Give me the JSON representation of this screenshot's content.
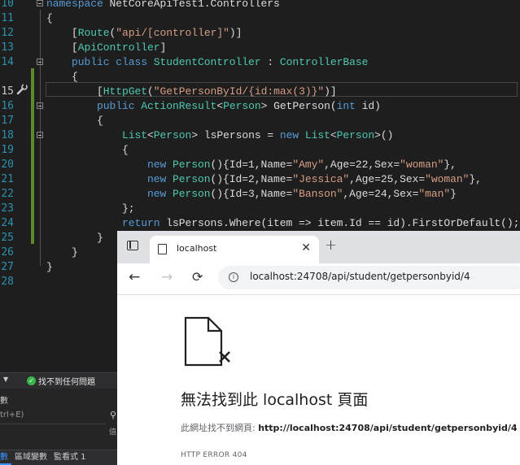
{
  "editor": {
    "lines": [
      {
        "n": "10",
        "tokens": [
          [
            "kw",
            "namespace "
          ],
          [
            "pl",
            "NetCoreApiTest1.Controllers"
          ]
        ]
      },
      {
        "n": "11",
        "tokens": [
          [
            "pl",
            "{"
          ]
        ]
      },
      {
        "n": "12",
        "tokens": [
          [
            "pl",
            "    ["
          ],
          [
            "at",
            "Route"
          ],
          [
            "pl",
            "("
          ],
          [
            "st",
            "\"api/[controller]\""
          ],
          [
            "pl",
            ")]"
          ]
        ]
      },
      {
        "n": "13",
        "tokens": [
          [
            "pl",
            "    ["
          ],
          [
            "at",
            "ApiController"
          ],
          [
            "pl",
            "]"
          ]
        ]
      },
      {
        "n": "14",
        "tokens": [
          [
            "kw",
            "    public class "
          ],
          [
            "ty",
            "StudentController"
          ],
          [
            "pl",
            " : "
          ],
          [
            "ty",
            "ControllerBase"
          ]
        ]
      },
      {
        "n": "14b",
        "tokens": [
          [
            "pl",
            "    {"
          ]
        ]
      },
      {
        "n": "15",
        "tokens": [
          [
            "pl",
            "        ["
          ],
          [
            "at",
            "HttpGet"
          ],
          [
            "pl",
            "("
          ],
          [
            "st",
            "\"GetPersonById/{id:max(3)}\""
          ],
          [
            "pl",
            ")]"
          ]
        ]
      },
      {
        "n": "16",
        "tokens": [
          [
            "kw",
            "        public "
          ],
          [
            "ty",
            "ActionResult"
          ],
          [
            "pl",
            "<"
          ],
          [
            "ty",
            "Person"
          ],
          [
            "pl",
            "> GetPerson("
          ],
          [
            "kw",
            "int"
          ],
          [
            "pl",
            " id)"
          ]
        ]
      },
      {
        "n": "17",
        "tokens": [
          [
            "pl",
            "        {"
          ]
        ]
      },
      {
        "n": "18",
        "tokens": [
          [
            "pl",
            "            "
          ],
          [
            "ty",
            "List"
          ],
          [
            "pl",
            "<"
          ],
          [
            "ty",
            "Person"
          ],
          [
            "pl",
            "> lsPersons = "
          ],
          [
            "kw",
            "new "
          ],
          [
            "ty",
            "List"
          ],
          [
            "pl",
            "<"
          ],
          [
            "ty",
            "Person"
          ],
          [
            "pl",
            ">()"
          ]
        ]
      },
      {
        "n": "19",
        "tokens": [
          [
            "pl",
            "            {"
          ]
        ]
      },
      {
        "n": "20",
        "tokens": [
          [
            "kw",
            "                new "
          ],
          [
            "ty",
            "Person"
          ],
          [
            "pl",
            "(){Id=1,Name="
          ],
          [
            "st",
            "\"Amy\""
          ],
          [
            "pl",
            ",Age=22,Sex="
          ],
          [
            "st",
            "\"woman\""
          ],
          [
            "pl",
            "},"
          ]
        ]
      },
      {
        "n": "21",
        "tokens": [
          [
            "kw",
            "                new "
          ],
          [
            "ty",
            "Person"
          ],
          [
            "pl",
            "(){Id=2,Name="
          ],
          [
            "st",
            "\"Jessica\""
          ],
          [
            "pl",
            ",Age=25,Sex="
          ],
          [
            "st",
            "\"woman\""
          ],
          [
            "pl",
            "},"
          ]
        ]
      },
      {
        "n": "22",
        "tokens": [
          [
            "kw",
            "                new "
          ],
          [
            "ty",
            "Person"
          ],
          [
            "pl",
            "(){Id=3,Name="
          ],
          [
            "st",
            "\"Banson\""
          ],
          [
            "pl",
            ",Age=24,Sex="
          ],
          [
            "st",
            "\"man\""
          ],
          [
            "pl",
            "}"
          ]
        ]
      },
      {
        "n": "23",
        "tokens": [
          [
            "pl",
            "            };"
          ]
        ]
      },
      {
        "n": "24",
        "tokens": [
          [
            "kw",
            "            return "
          ],
          [
            "pl",
            "lsPersons.Where(item => item.Id == id).FirstOrDefault();"
          ]
        ]
      },
      {
        "n": "25",
        "tokens": [
          [
            "pl",
            "        }"
          ]
        ]
      },
      {
        "n": "26",
        "tokens": [
          [
            "pl",
            "    }"
          ]
        ]
      },
      {
        "n": "27",
        "tokens": [
          [
            "pl",
            "}"
          ]
        ]
      },
      {
        "n": "28",
        "tokens": []
      }
    ],
    "line_numbers": [
      "10",
      "11",
      "12",
      "13",
      "14",
      "",
      "15",
      "16",
      "17",
      "18",
      "19",
      "20",
      "21",
      "22",
      "23",
      "24",
      "25",
      "26",
      "27",
      "28"
    ]
  },
  "bottom_panel": {
    "status_text": "找不到任何問題",
    "title": "數",
    "search_placeholder": "trl+E)",
    "side_text": "值",
    "tabs": [
      "數",
      "區域變數",
      "監看式 1"
    ]
  },
  "browser": {
    "tab_title": "localhost",
    "url": "localhost:24708/api/student/getpersonbyid/4",
    "error_title": "無法找到此 localhost 頁面",
    "error_desc_prefix": "此網址找不到網頁: ",
    "error_desc_url": "http://localhost:24708/api/student/getpersonbyid/4",
    "error_code": "HTTP ERROR 404"
  },
  "colors": {
    "keyword": "#569cd6",
    "type": "#4ec9b0",
    "string": "#d69d85",
    "plain": "#dcdcdc",
    "line_number": "#2b91af",
    "change_bar": "#5b8a2a"
  }
}
